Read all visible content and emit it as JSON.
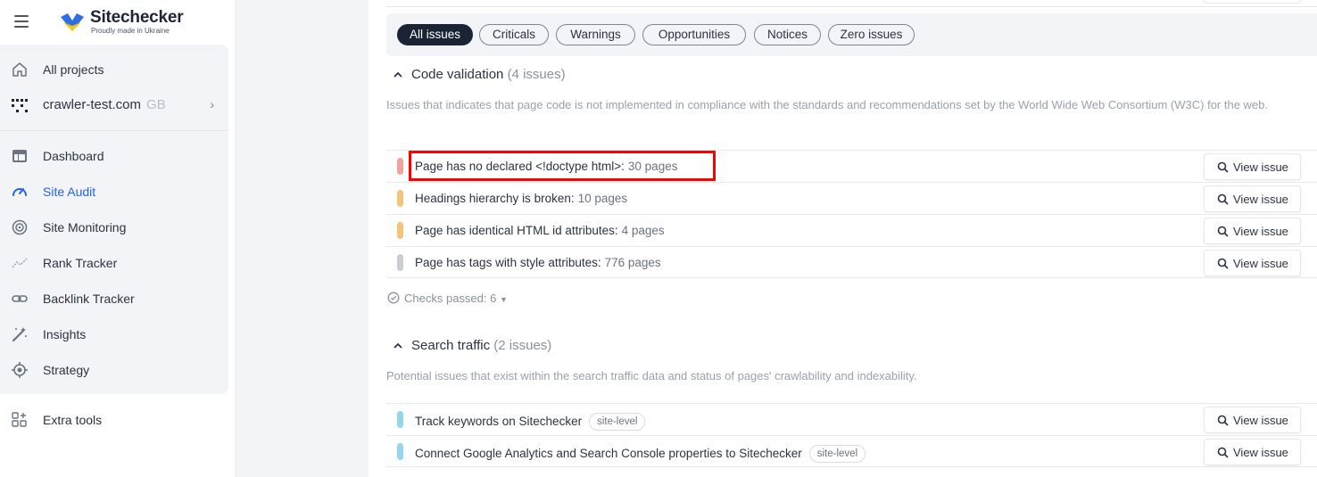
{
  "brand": {
    "name": "Sitechecker",
    "tagline": "Proudly made in Ukraine",
    "colors": {
      "blue": "#2f6fe0",
      "yellow": "#f5c518",
      "active_nav": "#2563eb"
    }
  },
  "sidebar": {
    "all_projects": "All projects",
    "project": {
      "domain": "crawler-test.com",
      "region": "GB"
    },
    "items": [
      {
        "label": "Dashboard",
        "icon": "dashboard-icon"
      },
      {
        "label": "Site Audit",
        "icon": "gauge-icon",
        "active": true
      },
      {
        "label": "Site Monitoring",
        "icon": "monitoring-icon"
      },
      {
        "label": "Rank Tracker",
        "icon": "rank-tracker-icon"
      },
      {
        "label": "Backlink Tracker",
        "icon": "link-icon"
      },
      {
        "label": "Insights",
        "icon": "magic-wand-icon"
      },
      {
        "label": "Strategy",
        "icon": "target-icon"
      }
    ],
    "extra_tools": "Extra tools"
  },
  "filters": [
    "All issues",
    "Criticals",
    "Warnings",
    "Opportunities",
    "Notices",
    "Zero issues"
  ],
  "sections": [
    {
      "title": "Code validation",
      "count": "(4 issues)",
      "description": "Issues that indicates that page code is not implemented in compliance with the standards and recommendations set by the World Wide Web Consortium (W3C) for the web.",
      "issues": [
        {
          "name": "Page has no declared <!doctype html>:",
          "pages": "30 pages",
          "severity": "critical",
          "color": "#f2a29b"
        },
        {
          "name": "Headings hierarchy is broken:",
          "pages": "10 pages",
          "severity": "warning",
          "color": "#f7c27a"
        },
        {
          "name": "Page has identical HTML id attributes:",
          "pages": "4 pages",
          "severity": "warning",
          "color": "#f7c27a"
        },
        {
          "name": "Page has tags with style attributes:",
          "pages": "776 pages",
          "severity": "notice",
          "color": "#c9cdd4"
        }
      ],
      "checks_passed": "Checks passed: 6"
    },
    {
      "title": "Search traffic",
      "count": "(2 issues)",
      "description": "Potential issues that exist within the search traffic data and status of pages' crawlability and indexability.",
      "issues": [
        {
          "name": "Track keywords on Sitechecker",
          "tag": "site-level",
          "severity": "opportunity",
          "color": "#93d6f2"
        },
        {
          "name": "Connect Google Analytics and Search Console properties to Sitechecker",
          "tag": "site-level",
          "severity": "opportunity",
          "color": "#93d6f2"
        }
      ]
    }
  ],
  "view_issue_label": "View issue"
}
